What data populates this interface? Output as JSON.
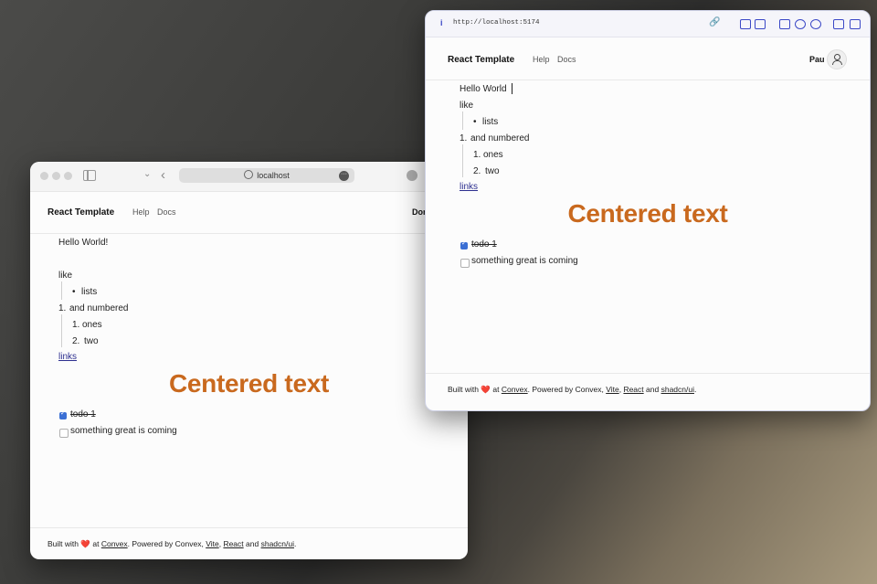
{
  "left_window": {
    "address": "localhost",
    "header": {
      "brand": "React Template",
      "nav": [
        "Help",
        "Docs"
      ],
      "user_partial": "Dor"
    },
    "content": {
      "hello": "Hello World!",
      "like": "like",
      "bullet": "lists",
      "numbered_marker": "1.",
      "numbered": "and numbered",
      "sub": [
        {
          "marker": "1.",
          "text": "ones"
        },
        {
          "marker": "2.",
          "text": "two"
        }
      ],
      "link": "links",
      "centered": "Centered text",
      "todos": [
        {
          "text": "todo 1",
          "done": true
        },
        {
          "text": "something great is coming",
          "done": false
        }
      ]
    },
    "footer": {
      "pre": "Built with",
      "heart": "❤️",
      "at": "at",
      "convex": "Convex",
      "mid": ". Powered by Convex,",
      "vite": "Vite",
      "comma": ",",
      "react": "React",
      "and": "and",
      "shadcn": "shadcn/ui",
      "end": "."
    }
  },
  "right_window": {
    "url": "http://localhost:5174",
    "header": {
      "brand": "React Template",
      "nav": [
        "Help",
        "Docs"
      ],
      "user": "Pau"
    },
    "content": {
      "hello": "Hello World",
      "like": "like",
      "bullet": "lists",
      "numbered_marker": "1.",
      "numbered": "and numbered",
      "sub": [
        {
          "marker": "1.",
          "text": "ones"
        },
        {
          "marker": "2.",
          "text": "two"
        }
      ],
      "link": "links",
      "centered": "Centered text",
      "todos": [
        {
          "text": "todo 1",
          "done": true
        },
        {
          "text": "something great is coming",
          "done": false
        }
      ]
    },
    "footer": {
      "pre": "Built with",
      "heart": "❤️",
      "at": "at",
      "convex": "Convex",
      "mid": ". Powered by Convex,",
      "vite": "Vite",
      "comma": ",",
      "react": "React",
      "and": "and",
      "shadcn": "shadcn/ui",
      "end": "."
    }
  },
  "colors": {
    "accent_text": "#c9691e",
    "link": "#2d2f8f",
    "checkbox": "#3b6fd4",
    "dev_toolbar": "#3b48c6"
  },
  "icons": [
    "sidebar-icon",
    "globe-icon",
    "more-icon",
    "info-icon",
    "link-icon",
    "camera-icon",
    "avatar-icon"
  ]
}
